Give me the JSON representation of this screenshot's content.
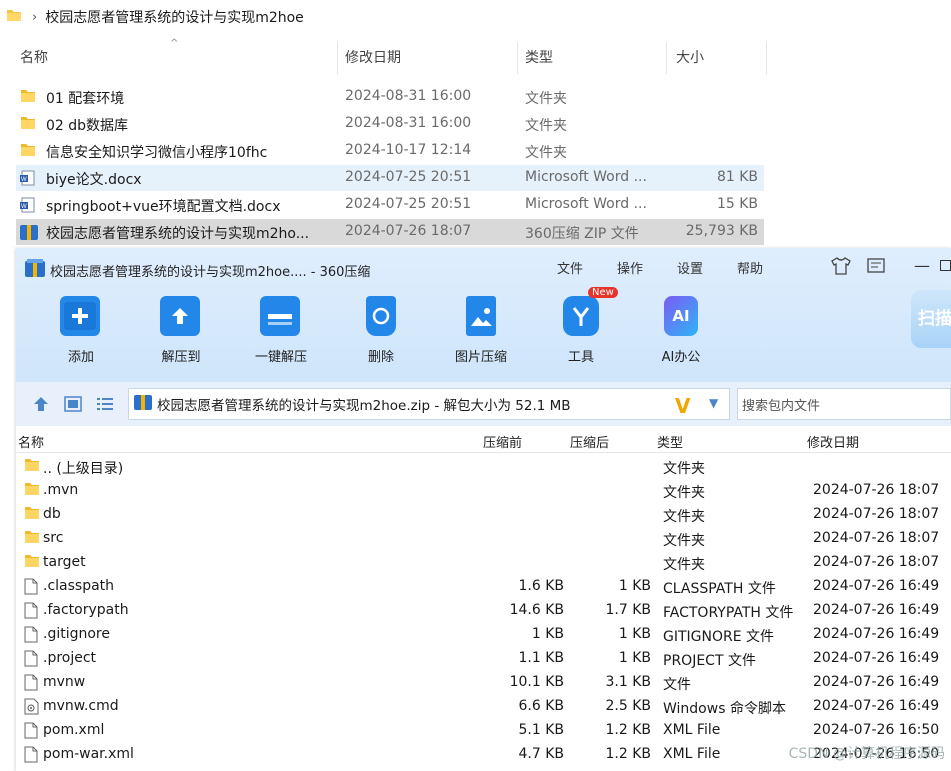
{
  "breadcrumb": {
    "path": "校园志愿者管理系统的设计与实现m2hoe"
  },
  "explorer": {
    "columns": {
      "name": "名称",
      "date": "修改日期",
      "type": "类型",
      "size": "大小"
    },
    "rows": [
      {
        "name": "01 配套环境",
        "date": "2024-08-31 16:00",
        "type": "文件夹",
        "size": "",
        "icon": "folder-icon"
      },
      {
        "name": "02 db数据库",
        "date": "2024-08-31 16:00",
        "type": "文件夹",
        "size": "",
        "icon": "folder-icon"
      },
      {
        "name": "信息安全知识学习微信小程序10fhc",
        "date": "2024-10-17 12:14",
        "type": "文件夹",
        "size": "",
        "icon": "folder-icon"
      },
      {
        "name": "biye论文.docx",
        "date": "2024-07-25 20:51",
        "type": "Microsoft Word ...",
        "size": "81 KB",
        "icon": "word-doc-icon"
      },
      {
        "name": "springboot+vue环境配置文档.docx",
        "date": "2024-07-25 20:51",
        "type": "Microsoft Word ...",
        "size": "15 KB",
        "icon": "word-doc-icon"
      },
      {
        "name": "校园志愿者管理系统的设计与实现m2ho...",
        "date": "2024-07-26 18:07",
        "type": "360压缩 ZIP 文件",
        "size": "25,793 KB",
        "icon": "zip-archive-icon"
      }
    ]
  },
  "zip": {
    "title": "校园志愿者管理系统的设计与实现m2hoe.... - 360压缩",
    "menu": [
      "文件",
      "操作",
      "设置",
      "帮助"
    ],
    "toolbar": [
      {
        "label": "添加",
        "icon": "add-icon"
      },
      {
        "label": "解压到",
        "icon": "extract-to-icon"
      },
      {
        "label": "一键解压",
        "icon": "one-click-extract-icon"
      },
      {
        "label": "删除",
        "icon": "delete-icon"
      },
      {
        "label": "图片压缩",
        "icon": "image-compress-icon"
      },
      {
        "label": "工具",
        "icon": "tools-icon"
      },
      {
        "label": "AI办公",
        "icon": "ai-office-icon"
      }
    ],
    "new_badge": "New",
    "ai_text": "AI",
    "scan_label": "扫描",
    "path": "校园志愿者管理系统的设计与实现m2hoe.zip - 解包大小为 52.1 MB",
    "search_placeholder": "搜索包内文件",
    "columns": {
      "name": "名称",
      "compressed_before": "压缩前",
      "compressed_after": "压缩后",
      "type": "类型",
      "date": "修改日期"
    },
    "rows": [
      {
        "name": ".. (上级目录)",
        "before": "",
        "after": "",
        "type": "文件夹",
        "date": "",
        "icon": "folder-icon"
      },
      {
        "name": ".mvn",
        "before": "",
        "after": "",
        "type": "文件夹",
        "date": "2024-07-26 18:07",
        "icon": "folder-icon"
      },
      {
        "name": "db",
        "before": "",
        "after": "",
        "type": "文件夹",
        "date": "2024-07-26 18:07",
        "icon": "folder-icon"
      },
      {
        "name": "src",
        "before": "",
        "after": "",
        "type": "文件夹",
        "date": "2024-07-26 18:07",
        "icon": "folder-icon"
      },
      {
        "name": "target",
        "before": "",
        "after": "",
        "type": "文件夹",
        "date": "2024-07-26 18:07",
        "icon": "folder-icon"
      },
      {
        "name": ".classpath",
        "before": "1.6 KB",
        "after": "1 KB",
        "type": "CLASSPATH 文件",
        "date": "2024-07-26 16:49",
        "icon": "file-icon"
      },
      {
        "name": ".factorypath",
        "before": "14.6 KB",
        "after": "1.7 KB",
        "type": "FACTORYPATH 文件",
        "date": "2024-07-26 16:49",
        "icon": "file-icon"
      },
      {
        "name": ".gitignore",
        "before": "1 KB",
        "after": "1 KB",
        "type": "GITIGNORE 文件",
        "date": "2024-07-26 16:49",
        "icon": "file-icon"
      },
      {
        "name": ".project",
        "before": "1.1 KB",
        "after": "1 KB",
        "type": "PROJECT 文件",
        "date": "2024-07-26 16:49",
        "icon": "file-icon"
      },
      {
        "name": "mvnw",
        "before": "10.1 KB",
        "after": "3.1 KB",
        "type": "文件",
        "date": "2024-07-26 16:49",
        "icon": "file-icon"
      },
      {
        "name": "mvnw.cmd",
        "before": "6.6 KB",
        "after": "2.5 KB",
        "type": "Windows 命令脚本",
        "date": "2024-07-26 16:49",
        "icon": "cmd-script-icon"
      },
      {
        "name": "pom.xml",
        "before": "5.1 KB",
        "after": "1.2 KB",
        "type": "XML File",
        "date": "2024-07-26 16:50",
        "icon": "file-icon"
      },
      {
        "name": "pom-war.xml",
        "before": "4.7 KB",
        "after": "1.2 KB",
        "type": "XML File",
        "date": "2024-07-26 16:50",
        "icon": "file-icon"
      }
    ]
  },
  "watermark": "CSDN @计算机程序源码",
  "colors": {
    "accent": "#1f86e5",
    "selection": "#e5f1fb",
    "zip_header": "#d6e9fc"
  }
}
